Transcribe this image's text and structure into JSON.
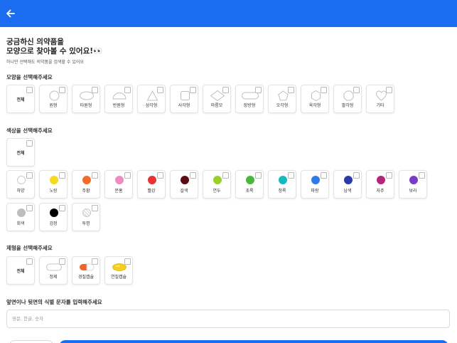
{
  "header": {
    "back_icon": "arrow-left-icon",
    "accent": "#1a6cf0"
  },
  "intro": {
    "line1": "궁금하신 의약품을",
    "line2": "모양으로 찾아볼 수 있어요!👀",
    "sub": "하나만 선택해도 의약품을 검색할 수 있어요"
  },
  "shape": {
    "title": "모양을 선택해주세요",
    "options": [
      {
        "label": "전체",
        "icon": "none"
      },
      {
        "label": "원형",
        "icon": "circle-icon"
      },
      {
        "label": "타원형",
        "icon": "ellipse-icon"
      },
      {
        "label": "반원형",
        "icon": "semicircle-icon"
      },
      {
        "label": "삼각형",
        "icon": "triangle-icon"
      },
      {
        "label": "사각형",
        "icon": "square-icon"
      },
      {
        "label": "마름모",
        "icon": "diamond-icon"
      },
      {
        "label": "장방형",
        "icon": "rectangle-icon"
      },
      {
        "label": "오각형",
        "icon": "pentagon-icon"
      },
      {
        "label": "육각형",
        "icon": "hexagon-icon"
      },
      {
        "label": "팔각형",
        "icon": "octagon-icon"
      },
      {
        "label": "기타",
        "icon": "heart-icon"
      }
    ]
  },
  "color": {
    "title": "색상을 선택해주세요",
    "all_label": "전체",
    "options": [
      {
        "label": "하양",
        "color": "#ffffff"
      },
      {
        "label": "노랑",
        "color": "#f6d81e"
      },
      {
        "label": "주황",
        "color": "#f26b2a"
      },
      {
        "label": "분홍",
        "color": "#f08cbd"
      },
      {
        "label": "빨강",
        "color": "#e83236"
      },
      {
        "label": "갈색",
        "color": "#5c0a14"
      },
      {
        "label": "연두",
        "color": "#9ccf2a"
      },
      {
        "label": "초록",
        "color": "#48b83a"
      },
      {
        "label": "청록",
        "color": "#16b8c4"
      },
      {
        "label": "파랑",
        "color": "#2d7be8"
      },
      {
        "label": "남색",
        "color": "#2a3aa8"
      },
      {
        "label": "자주",
        "color": "#b3267a"
      },
      {
        "label": "보라",
        "color": "#7a3bc8"
      },
      {
        "label": "회색",
        "color": "#bdbdbd"
      },
      {
        "label": "검정",
        "color": "#000000"
      },
      {
        "label": "투명",
        "color": "transparent"
      }
    ]
  },
  "form": {
    "title": "제형을 선택해주세요",
    "options": [
      {
        "label": "전체",
        "icon": "none"
      },
      {
        "label": "정제",
        "icon": "tablet-icon"
      },
      {
        "label": "경질캡슐",
        "icon": "hard-capsule-icon"
      },
      {
        "label": "연질캡슐",
        "icon": "soft-capsule-icon"
      }
    ]
  },
  "imprint": {
    "title": "앞면이나 뒷면의 식별 문자를 입력해주세요",
    "placeholder": "영문, 한글, 숫자",
    "value": ""
  }
}
